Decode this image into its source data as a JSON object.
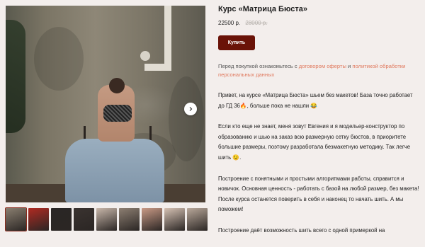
{
  "product": {
    "title": "Курс «Матрица Бюста»",
    "price": "22500 р.",
    "old_price": "28000 р.",
    "buy_label": "Купить"
  },
  "consent": {
    "before": "Перед покупкой ознакомьтесь с ",
    "offer_link": "договором оферты",
    "and": " и ",
    "policy_link": "политикой обработки персональных данных"
  },
  "description": {
    "p1": "Привет, на курсе «Матрица Бюста» шьем без макетов! База точно работает до ГД 36🔥, больше пока не нашли 😂",
    "p2": "Если кто еще не знает, меня зовут Евгения и я модельер-конструктор по образованию и шью на заказ всю размерную сетку бюстов, в приоритете большие размеры, поэтому разработала безмакетную методику. Так легче шить 😉.",
    "p3": "Построение с понятными и простыми алгоритмами работы, справится и новичок. Основная ценность - работать с базой на любой размер, без макета! После курса останется поверить в себя и наконец то начать шить. А мы поможем!",
    "p4": "Построение даёт возможность шить всего с одной примеркой на"
  },
  "gallery": {
    "next_icon": "chevron-right-icon",
    "thumb_colors": [
      "#8a7f70",
      "#b02a22",
      "#2a2625",
      "#3a3330",
      "#c8b7aa",
      "#8d7f72",
      "#c99a86",
      "#d6c2b4",
      "#b9a89a"
    ]
  }
}
